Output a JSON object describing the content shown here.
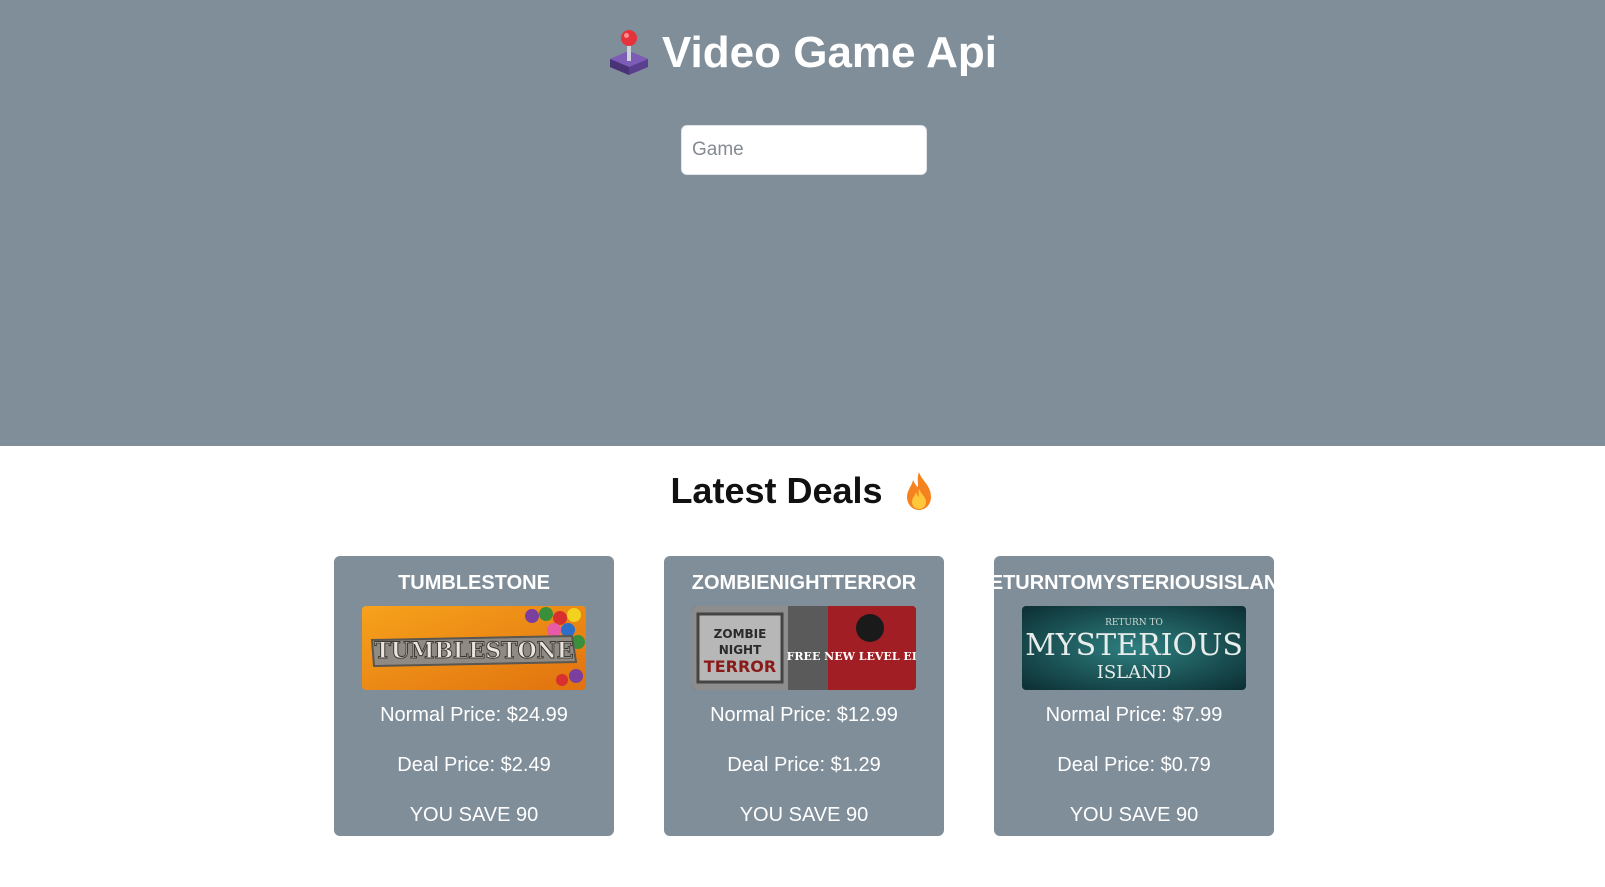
{
  "header": {
    "title": "Video Game Api",
    "icon": "joystick-icon"
  },
  "search": {
    "placeholder": "Game",
    "value": ""
  },
  "deals_section": {
    "title": "Latest Deals",
    "icon": "fire-icon"
  },
  "deals": [
    {
      "title": "TUMBLESTONE",
      "thumbnail_text": "TUMBLESTONE",
      "normal_price": "Normal Price: $24.99",
      "deal_price": "Deal Price: $2.49",
      "savings": "YOU SAVE 90"
    },
    {
      "title": "ZOMBIENIGHTTERROR",
      "thumbnail_text": "FREE NEW LEVEL EDITOR",
      "normal_price": "Normal Price: $12.99",
      "deal_price": "Deal Price: $1.29",
      "savings": "YOU SAVE 90"
    },
    {
      "title": "RETURNTOMYSTERIOUSISLAND",
      "thumbnail_text": "MYSTERIOUS",
      "thumbnail_subtext": "ISLAND",
      "thumbnail_kicker": "RETURN TO",
      "normal_price": "Normal Price: $7.99",
      "deal_price": "Deal Price: $0.79",
      "savings": "YOU SAVE 90"
    }
  ],
  "colors": {
    "hero_bg": "#808e99",
    "card_bg": "#808e99",
    "text_light": "#ffffff",
    "text_dark": "#111111"
  }
}
